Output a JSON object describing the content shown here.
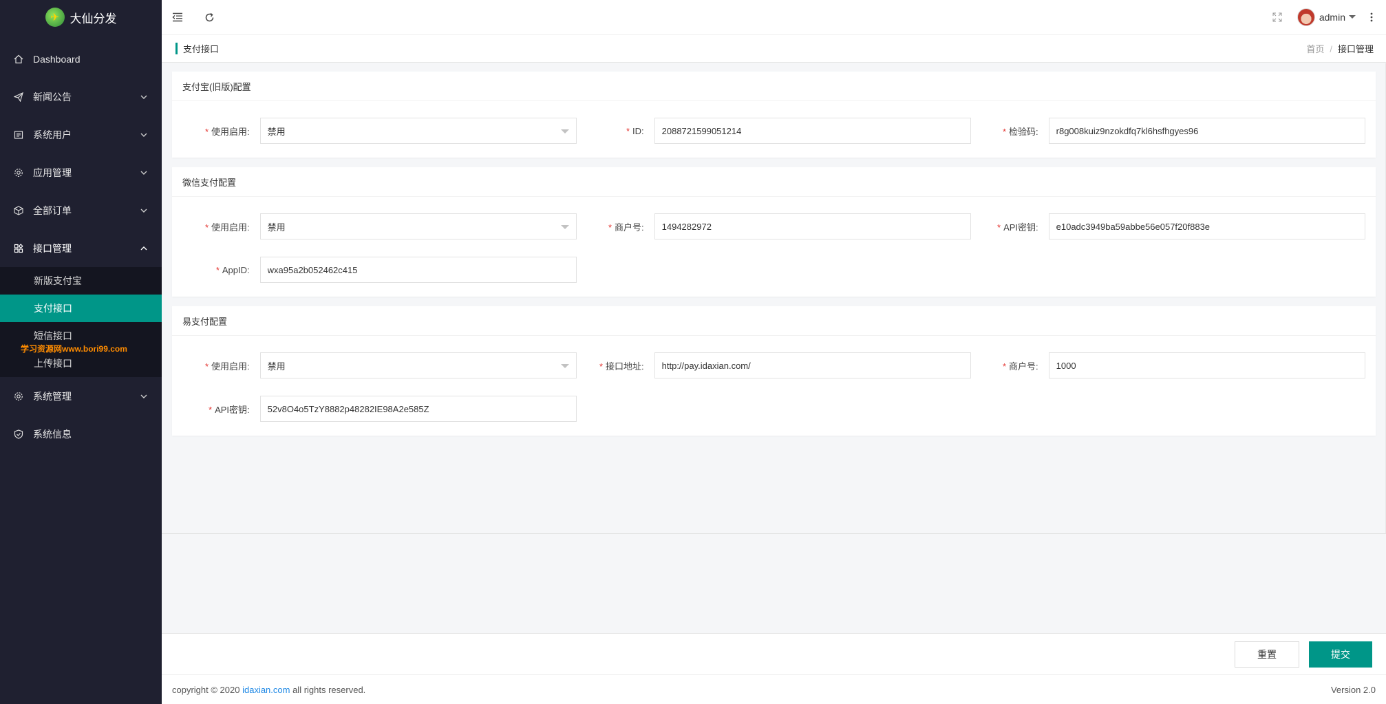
{
  "app": {
    "name": "大仙分发"
  },
  "sidebar": {
    "items": [
      {
        "label": "Dashboard",
        "icon": "home-icon"
      },
      {
        "label": "新闻公告",
        "icon": "send-icon"
      },
      {
        "label": "系统用户",
        "icon": "users-icon"
      },
      {
        "label": "应用管理",
        "icon": "gear-icon"
      },
      {
        "label": "全部订单",
        "icon": "box-icon"
      },
      {
        "label": "接口管理",
        "icon": "api-icon"
      },
      {
        "label": "系统管理",
        "icon": "gear-icon"
      },
      {
        "label": "系统信息",
        "icon": "shield-icon"
      }
    ],
    "sub_items": [
      "新版支付宝",
      "支付接口",
      "短信接口",
      "上传接口"
    ],
    "watermark": "学习资源网www.bori99.com"
  },
  "header": {
    "user": "admin"
  },
  "titlebar": {
    "title": "支付接口",
    "breadcrumb": [
      "首页",
      "接口管理"
    ],
    "separator": "/"
  },
  "sections": {
    "alipay": {
      "title": "支付宝(旧版)配置",
      "enable_label": "使用启用:",
      "enable_value": "禁用",
      "id_label": "ID:",
      "id_value": "2088721599051214",
      "key_label": "检验码:",
      "key_value": "r8g008kuiz9nzokdfq7kl6hsfhgyes96"
    },
    "wechat": {
      "title": "微信支付配置",
      "enable_label": "使用启用:",
      "enable_value": "禁用",
      "mch_label": "商户号:",
      "mch_value": "1494282972",
      "apikey_label": "API密钥:",
      "apikey_value": "e10adc3949ba59abbe56e057f20f883e",
      "appid_label": "AppID:",
      "appid_value": "wxa95a2b052462c415"
    },
    "epay": {
      "title": "易支付配置",
      "enable_label": "使用启用:",
      "enable_value": "禁用",
      "url_label": "接口地址:",
      "url_value": "http://pay.idaxian.com/",
      "mch_label": "商户号:",
      "mch_value": "1000",
      "apikey_label": "API密钥:",
      "apikey_value": "52v8O4o5TzY8882p48282IE98A2e585Z"
    }
  },
  "required_mark": "*",
  "actions": {
    "reset": "重置",
    "submit": "提交"
  },
  "footer": {
    "prefix": "copyright © 2020 ",
    "link": "idaxian.com",
    "suffix": " all rights reserved.",
    "version": "Version 2.0"
  },
  "colors": {
    "accent": "#009688",
    "sidebar_bg": "#1f2030",
    "required": "#e53935"
  }
}
